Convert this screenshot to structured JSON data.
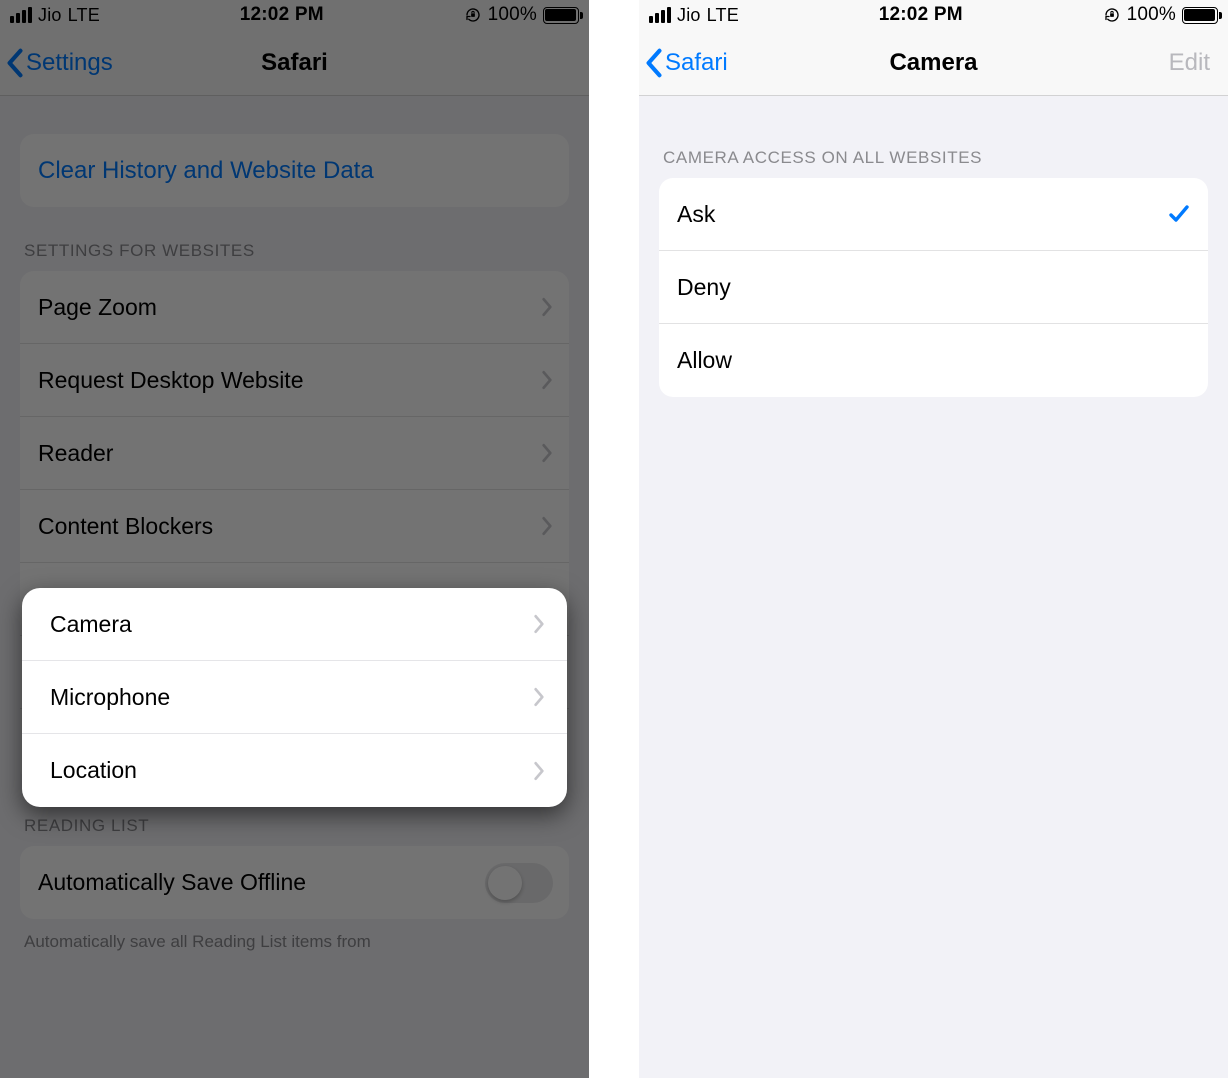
{
  "left": {
    "status": {
      "carrier": "Jio",
      "network": "LTE",
      "time": "12:02 PM",
      "battery_pct": "100%"
    },
    "nav": {
      "back": "Settings",
      "title": "Safari"
    },
    "clear_label": "Clear History and Website Data",
    "section_websites": "SETTINGS FOR WEBSITES",
    "rows_bg": {
      "page_zoom": "Page Zoom",
      "desktop": "Request Desktop Website",
      "reader": "Reader",
      "blockers": "Content Blockers"
    },
    "highlight_rows": {
      "camera": "Camera",
      "microphone": "Microphone",
      "location": "Location"
    },
    "section_reading": "READING LIST",
    "auto_save": "Automatically Save Offline",
    "footer": "Automatically save all Reading List items from"
  },
  "right": {
    "status": {
      "carrier": "Jio",
      "network": "LTE",
      "time": "12:02 PM",
      "battery_pct": "100%"
    },
    "nav": {
      "back": "Safari",
      "title": "Camera",
      "edit": "Edit"
    },
    "section": "CAMERA ACCESS ON ALL WEBSITES",
    "options": {
      "ask": "Ask",
      "deny": "Deny",
      "allow": "Allow"
    },
    "selected": "ask"
  }
}
